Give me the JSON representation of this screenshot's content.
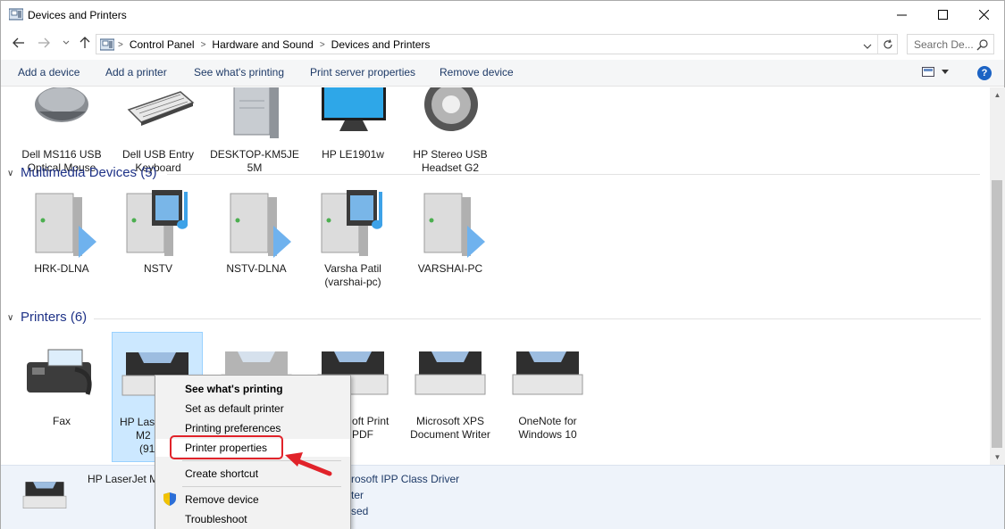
{
  "window": {
    "title": "Devices and Printers"
  },
  "address": {
    "crumbs": [
      "Control Panel",
      "Hardware and Sound",
      "Devices and Printers"
    ]
  },
  "search": {
    "placeholder": "Search De..."
  },
  "commands": [
    "Add a device",
    "Add a printer",
    "See what's printing",
    "Print server properties",
    "Remove device"
  ],
  "groups": {
    "devices": {
      "items": [
        {
          "label1": "Dell MS116 USB",
          "label2": "Optical Mouse",
          "icon": "mouse-icon"
        },
        {
          "label1": "Dell USB Entry",
          "label2": "Keyboard",
          "icon": "keyboard-icon"
        },
        {
          "label1": "DESKTOP-KM5JE",
          "label2": "5M",
          "icon": "computer-tower-icon"
        },
        {
          "label1": "HP LE1901w",
          "label2": "",
          "icon": "monitor-icon"
        },
        {
          "label1": "HP Stereo USB",
          "label2": "Headset G2",
          "icon": "speaker-icon"
        }
      ]
    },
    "multimedia": {
      "label": "Multimedia Devices (5)",
      "items": [
        {
          "label1": "HRK-DLNA",
          "label2": "",
          "icon": "media-server-icon"
        },
        {
          "label1": "NSTV",
          "label2": "",
          "icon": "media-renderer-icon"
        },
        {
          "label1": "NSTV-DLNA",
          "label2": "",
          "icon": "media-server-icon"
        },
        {
          "label1": "Varsha Patil",
          "label2": "(varshai-pc)",
          "icon": "media-renderer-icon"
        },
        {
          "label1": "VARSHAI-PC",
          "label2": "",
          "icon": "media-server-icon"
        }
      ]
    },
    "printers": {
      "label": "Printers (6)",
      "items": [
        {
          "label1": "Fax",
          "label2": "",
          "label3": "",
          "icon": "fax-icon"
        },
        {
          "label1": "HP Las",
          "label2": "M2",
          "label3": "(91",
          "icon": "printer-icon"
        },
        {
          "label1": "",
          "label2": "",
          "label3": "",
          "icon": "printer-icon"
        },
        {
          "label1": "oft Print",
          "label2": "PDF",
          "label3": "",
          "icon": "printer-icon"
        },
        {
          "label1": "Microsoft XPS",
          "label2": "Document Writer",
          "label3": "",
          "icon": "printer-icon"
        },
        {
          "label1": "OneNote for",
          "label2": "Windows 10",
          "label3": "",
          "icon": "printer-icon"
        }
      ]
    }
  },
  "details": {
    "name": "HP LaserJet M",
    "line1": "rosoft IPP Class Driver",
    "line2": "ter",
    "line3": "sed"
  },
  "context_menu": {
    "items": [
      "See what's printing",
      "Set as default printer",
      "Printing preferences",
      "Printer properties",
      "Create shortcut",
      "Remove device",
      "Troubleshoot"
    ]
  },
  "colors": {
    "accent": "#1e3287",
    "highlight": "#e1232a",
    "selection": "#cce8ff"
  }
}
